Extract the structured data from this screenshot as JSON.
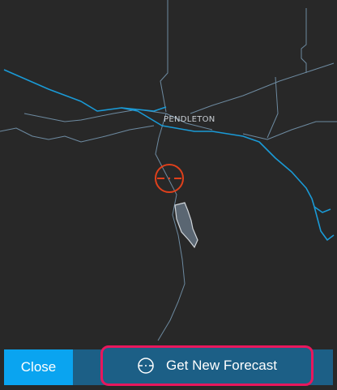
{
  "map": {
    "place_label": "PENDLETON",
    "colors": {
      "background": "#282828",
      "roads": "#6d8aa0",
      "rivers": "#1a9ad6",
      "target": "#e0401b",
      "area_fill": "#5a6672"
    },
    "icons": [
      "crosshair-target-icon"
    ]
  },
  "actions": {
    "close_label": "Close",
    "forecast_label": "Get New Forecast",
    "forecast_icon": "crosshair-circle-icon",
    "bar_color": "#1c5f86",
    "close_color": "#0aa4f0",
    "highlight_color": "#e8175d"
  }
}
